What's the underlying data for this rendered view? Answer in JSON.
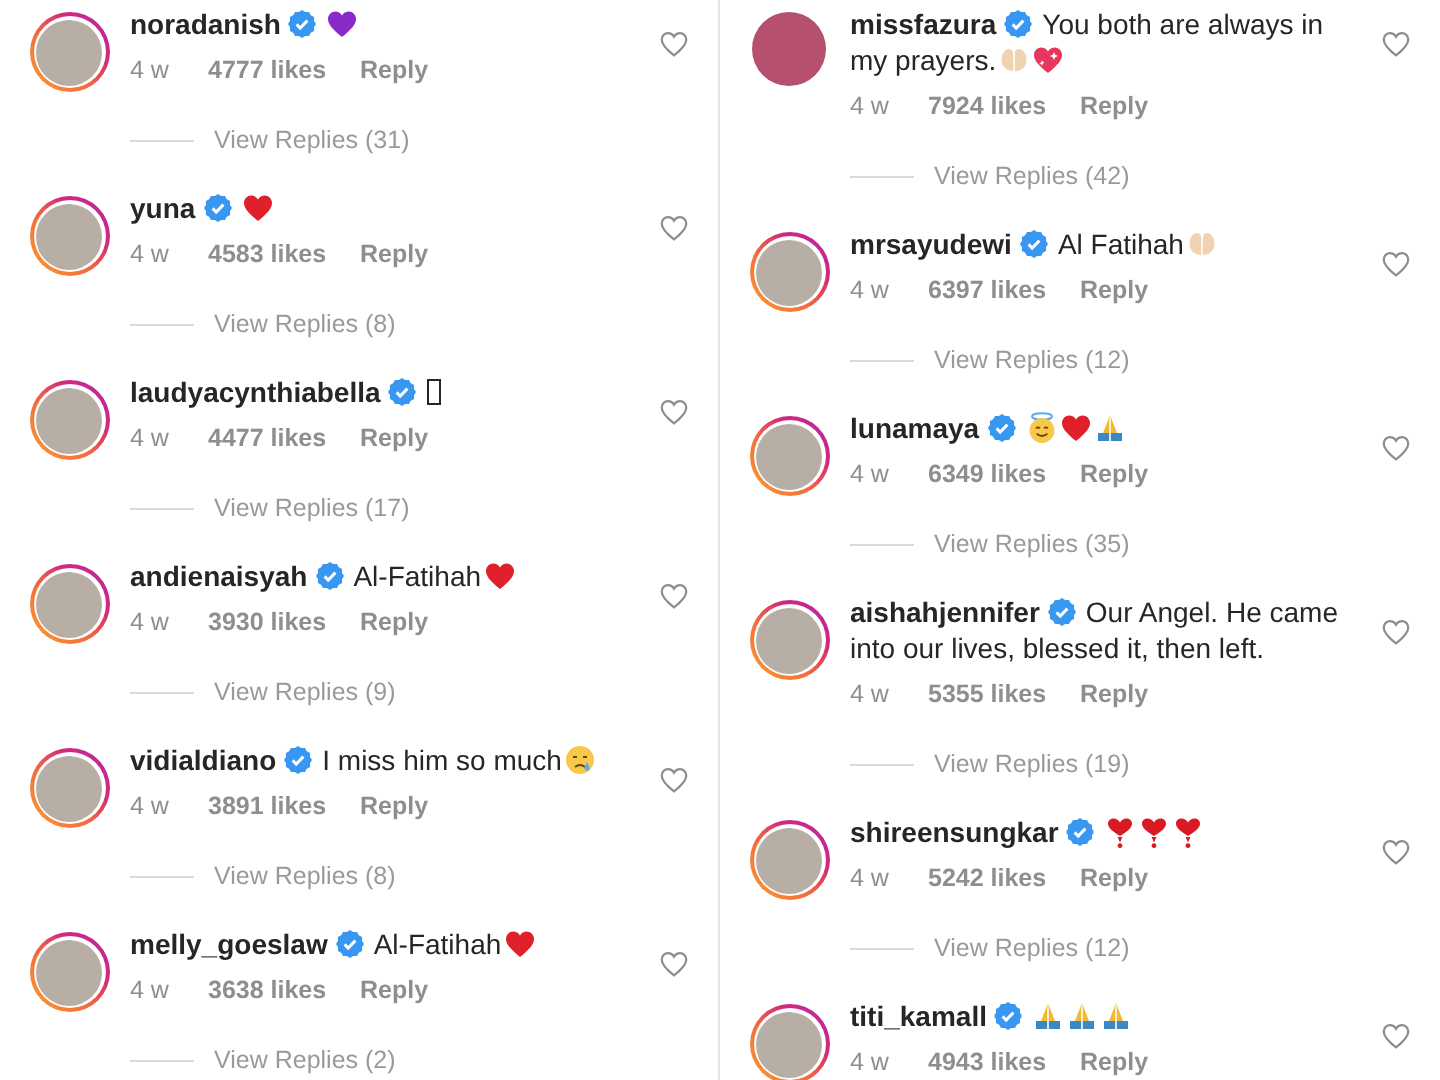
{
  "columns": [
    {
      "comments": [
        {
          "username": "noradanish",
          "verified": true,
          "story_ring": true,
          "emojis": [
            {
              "kind": "purple-heart"
            }
          ],
          "time": "4 w",
          "likes": "4777 likes",
          "reply": "Reply",
          "view_replies": "View Replies (31)"
        },
        {
          "username": "yuna",
          "verified": true,
          "story_ring": true,
          "emojis": [
            {
              "kind": "red-heart"
            }
          ],
          "time": "4 w",
          "likes": "4583 likes",
          "reply": "Reply",
          "view_replies": "View Replies (8)"
        },
        {
          "username": "laudyacynthiabella",
          "verified": true,
          "story_ring": true,
          "emojis": [
            {
              "kind": "missing-glyph"
            }
          ],
          "time": "4 w",
          "likes": "4477 likes",
          "reply": "Reply",
          "view_replies": "View Replies (17)"
        },
        {
          "username": "andienaisyah",
          "verified": true,
          "story_ring": true,
          "text": "Al-Fatihah",
          "emojis": [
            {
              "kind": "red-heart"
            }
          ],
          "time": "4 w",
          "likes": "3930 likes",
          "reply": "Reply",
          "view_replies": "View Replies (9)"
        },
        {
          "username": "vidialdiano",
          "verified": true,
          "story_ring": true,
          "text": "I miss him so much",
          "emojis": [
            {
              "kind": "crying-face"
            }
          ],
          "time": "4 w",
          "likes": "3891 likes",
          "reply": "Reply",
          "view_replies": "View Replies (8)"
        },
        {
          "username": "melly_goeslaw",
          "verified": true,
          "story_ring": true,
          "text": "Al-Fatihah",
          "emojis": [
            {
              "kind": "red-heart"
            }
          ],
          "time": "4 w",
          "likes": "3638 likes",
          "reply": "Reply",
          "view_replies": "View Replies (2)"
        }
      ]
    },
    {
      "comments": [
        {
          "username": "missfazura",
          "verified": true,
          "story_ring": false,
          "text": "You both are always in",
          "text_continued": "my prayers.",
          "emojis": [
            {
              "kind": "open-palms"
            },
            {
              "kind": "sparkling-heart"
            }
          ],
          "time": "4 w",
          "likes": "7924 likes",
          "reply": "Reply",
          "view_replies": "View Replies (42)"
        },
        {
          "username": "mrsayudewi",
          "verified": true,
          "story_ring": true,
          "text": "Al Fatihah",
          "emojis": [
            {
              "kind": "open-palms"
            }
          ],
          "time": "4 w",
          "likes": "6397 likes",
          "reply": "Reply",
          "view_replies": "View Replies (12)"
        },
        {
          "username": "lunamaya",
          "verified": true,
          "story_ring": true,
          "emojis": [
            {
              "kind": "halo-face"
            },
            {
              "kind": "red-heart"
            },
            {
              "kind": "folded-hands"
            }
          ],
          "time": "4 w",
          "likes": "6349 likes",
          "reply": "Reply",
          "view_replies": "View Replies (35)"
        },
        {
          "username": "aishahjennifer",
          "verified": true,
          "story_ring": true,
          "text": "Our Angel. He came",
          "text_continued": "into our lives, blessed it, then left.",
          "time": "4 w",
          "likes": "5355 likes",
          "reply": "Reply",
          "view_replies": "View Replies (19)"
        },
        {
          "username": "shireensungkar",
          "verified": true,
          "story_ring": true,
          "emojis": [
            {
              "kind": "heart-exclamation"
            },
            {
              "kind": "heart-exclamation"
            },
            {
              "kind": "heart-exclamation"
            }
          ],
          "time": "4 w",
          "likes": "5242 likes",
          "reply": "Reply",
          "view_replies": "View Replies (12)"
        },
        {
          "username": "titi_kamall",
          "verified": true,
          "story_ring": true,
          "emojis": [
            {
              "kind": "folded-hands"
            },
            {
              "kind": "folded-hands"
            },
            {
              "kind": "folded-hands"
            }
          ],
          "time": "4 w",
          "likes": "4943 likes",
          "reply": "Reply"
        }
      ]
    }
  ]
}
